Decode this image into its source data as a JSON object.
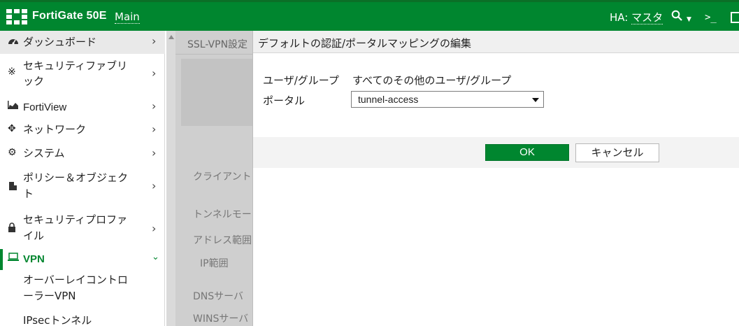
{
  "header": {
    "brand": "FortiGate 50E",
    "vdom": "Main",
    "ha_label": "HA:",
    "ha_value": "マスタ",
    "search_icon": "search-icon",
    "cli_icon": "cli-icon",
    "cli_glyph": ">_",
    "fullscreen_icon": "fullscreen-icon"
  },
  "sidebar": {
    "items": [
      {
        "label": "ダッシュボード",
        "icon": "dashboard-icon"
      },
      {
        "label": "セキュリティファブリ",
        "label2": "ック",
        "icon": "fabric-icon"
      },
      {
        "label": "FortiView",
        "icon": "fortiview-icon"
      },
      {
        "label": "ネットワーク",
        "icon": "network-icon"
      },
      {
        "label": "システム",
        "icon": "system-icon"
      },
      {
        "label": "ポリシー＆オブジェク",
        "label2": "ト",
        "icon": "policy-icon"
      },
      {
        "label": "セキュリティプロファ",
        "label2": "イル",
        "icon": "lock-icon"
      },
      {
        "label": "VPN",
        "icon": "vpn-icon"
      },
      {
        "label": "オーバーレイコントロ",
        "label2": "ーラーVPN"
      },
      {
        "label": "IPsecトンネル"
      }
    ]
  },
  "background": {
    "tab": "SSL-VPN設定",
    "labels": [
      "クライアント",
      "トンネルモー",
      "アドレス範囲",
      "IP範囲",
      "DNSサーバ",
      "WINSサーバ"
    ]
  },
  "dialog": {
    "title": "デフォルトの認証/ポータルマッピングの編集",
    "user_group_label": "ユーザ/グループ",
    "user_group_value": "すべてのその他のユーザ/グループ",
    "portal_label": "ポータル",
    "portal_value": "tunnel-access",
    "ok": "OK",
    "cancel": "キャンセル"
  },
  "colors": {
    "brand_green": "#00862f"
  }
}
